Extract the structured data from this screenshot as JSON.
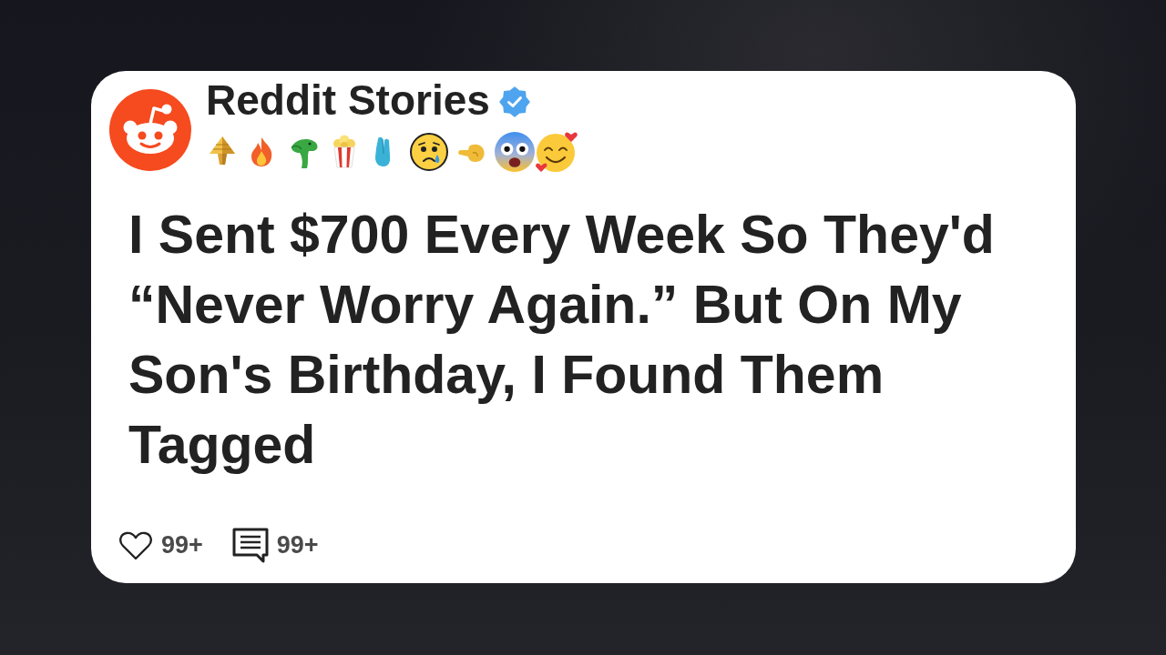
{
  "post": {
    "author": "Reddit Stories",
    "verified": true,
    "title": "I Sent $700 Every Week So They'd “Never Worry Again.” But On My Son's Birthday, I Found Them Tagged",
    "likes": "99+",
    "comments": "99+"
  }
}
